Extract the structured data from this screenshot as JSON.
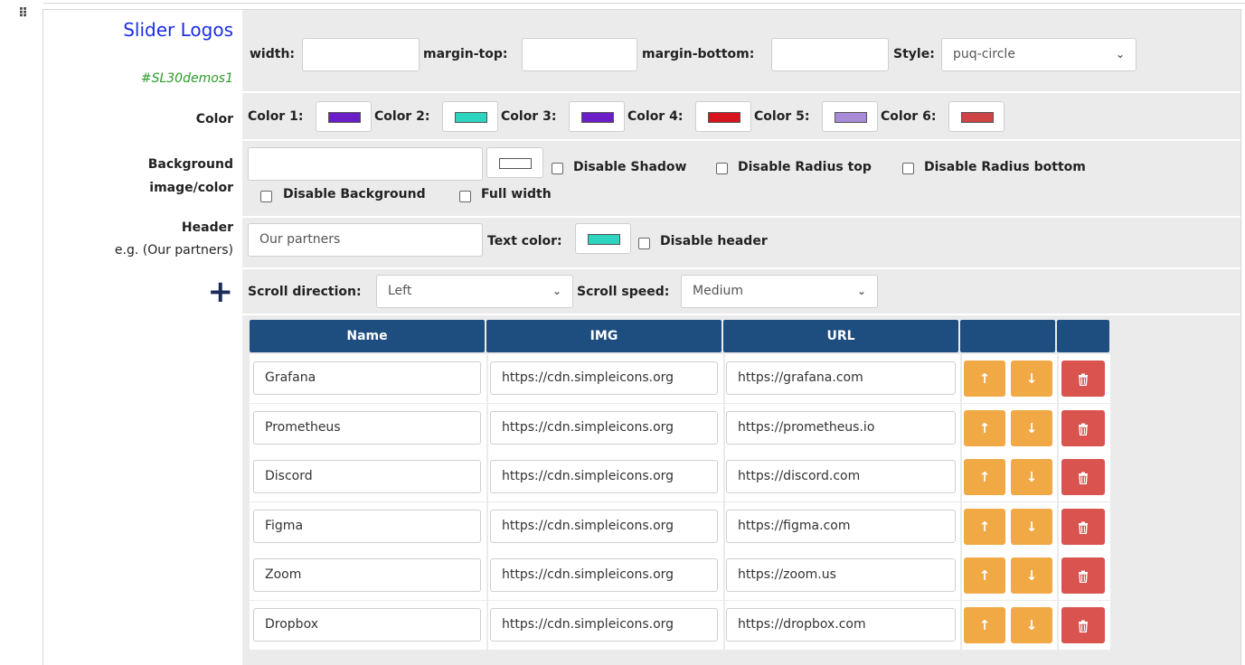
{
  "block": {
    "title": "Slider Logos",
    "id_tag": "#SL30demos1"
  },
  "settings": {
    "width_label": "width:",
    "width_value": "",
    "margin_top_label": "margin-top:",
    "margin_top_value": "",
    "margin_bottom_label": "margin-bottom:",
    "margin_bottom_value": "",
    "style_label": "Style:",
    "style_value": "puq-circle"
  },
  "colors": {
    "row_label": "Color",
    "items": [
      {
        "label": "Color 1:",
        "hex": "#6a1fc6"
      },
      {
        "label": "Color 2:",
        "hex": "#2dd4bf"
      },
      {
        "label": "Color 3:",
        "hex": "#6a1fc6"
      },
      {
        "label": "Color 4:",
        "hex": "#d7141e"
      },
      {
        "label": "Color 5:",
        "hex": "#a98ad9"
      },
      {
        "label": "Color 6:",
        "hex": "#cc4444"
      }
    ]
  },
  "background": {
    "row_label_line1": "Background",
    "row_label_line2": "image/color",
    "value": "",
    "color_hex": "#ffffff",
    "disable_shadow": "Disable Shadow",
    "disable_radius_top": "Disable Radius top",
    "disable_radius_bottom": "Disable Radius bottom",
    "disable_background": "Disable Background",
    "full_width": "Full width"
  },
  "header": {
    "row_label_line1": "Header",
    "row_label_line2": "e.g. (Our partners)",
    "value": "Our partners",
    "text_color_label": "Text color:",
    "text_color_hex": "#2dd4bf",
    "disable_header": "Disable header"
  },
  "scroll": {
    "plus_icon": "plus-icon",
    "direction_label": "Scroll direction:",
    "direction_value": "Left",
    "speed_label": "Scroll speed:",
    "speed_value": "Medium"
  },
  "table": {
    "headers": [
      "Name",
      "IMG",
      "URL",
      "",
      ""
    ],
    "rows": [
      {
        "name": "Grafana",
        "img": "https://cdn.simpleicons.org",
        "url": "https://grafana.com"
      },
      {
        "name": "Prometheus",
        "img": "https://cdn.simpleicons.org",
        "url": "https://prometheus.io"
      },
      {
        "name": "Discord",
        "img": "https://cdn.simpleicons.org",
        "url": "https://discord.com"
      },
      {
        "name": "Figma",
        "img": "https://cdn.simpleicons.org",
        "url": "https://figma.com"
      },
      {
        "name": "Zoom",
        "img": "https://cdn.simpleicons.org",
        "url": "https://zoom.us"
      },
      {
        "name": "Dropbox",
        "img": "https://cdn.simpleicons.org",
        "url": "https://dropbox.com"
      }
    ],
    "up_icon": "arrow-up-icon",
    "down_icon": "arrow-down-icon",
    "delete_icon": "trash-icon",
    "brand_colors": {
      "header": "#1e4e80",
      "move": "#f0a945",
      "delete": "#d9534f"
    }
  }
}
